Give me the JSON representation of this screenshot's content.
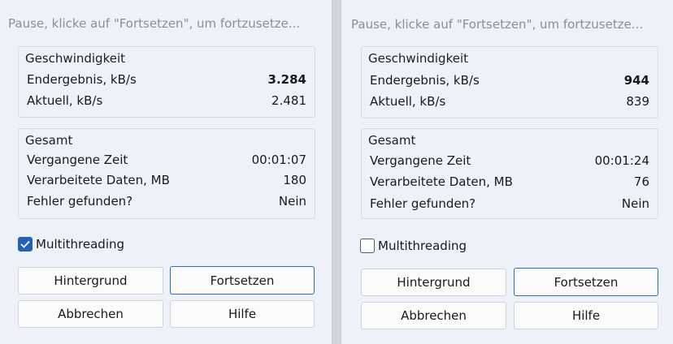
{
  "windows": [
    {
      "title": "Pause, klicke auf \"Fortsetzen\", um fortzusetze...",
      "speed": {
        "label": "Geschwindigkeit",
        "final_label": "Endergebnis, kB/s",
        "final_value": "3.284",
        "current_label": "Aktuell, kB/s",
        "current_value": "2.481"
      },
      "total": {
        "label": "Gesamt",
        "elapsed_label": "Vergangene Zeit",
        "elapsed_value": "00:01:07",
        "data_label": "Verarbeitete Daten, MB",
        "data_value": "180",
        "errors_label": "Fehler gefunden?",
        "errors_value": "Nein"
      },
      "multithreading_label": "Multithreading",
      "multithreading_checked": true,
      "buttons": {
        "background": "Hintergrund",
        "resume": "Fortsetzen",
        "cancel": "Abbrechen",
        "help": "Hilfe"
      }
    },
    {
      "title": "Pause, klicke auf \"Fortsetzen\", um fortzusetze...",
      "speed": {
        "label": "Geschwindigkeit",
        "final_label": "Endergebnis, kB/s",
        "final_value": "944",
        "current_label": "Aktuell, kB/s",
        "current_value": "839"
      },
      "total": {
        "label": "Gesamt",
        "elapsed_label": "Vergangene Zeit",
        "elapsed_value": "00:01:24",
        "data_label": "Verarbeitete Daten, MB",
        "data_value": "76",
        "errors_label": "Fehler gefunden?",
        "errors_value": "Nein"
      },
      "multithreading_label": "Multithreading",
      "multithreading_checked": false,
      "buttons": {
        "background": "Hintergrund",
        "resume": "Fortsetzen",
        "cancel": "Abbrechen",
        "help": "Hilfe"
      }
    }
  ],
  "colors": {
    "accent": "#1f62b6",
    "window_bg": "#eef1f7",
    "title_text": "#8a8f98"
  }
}
